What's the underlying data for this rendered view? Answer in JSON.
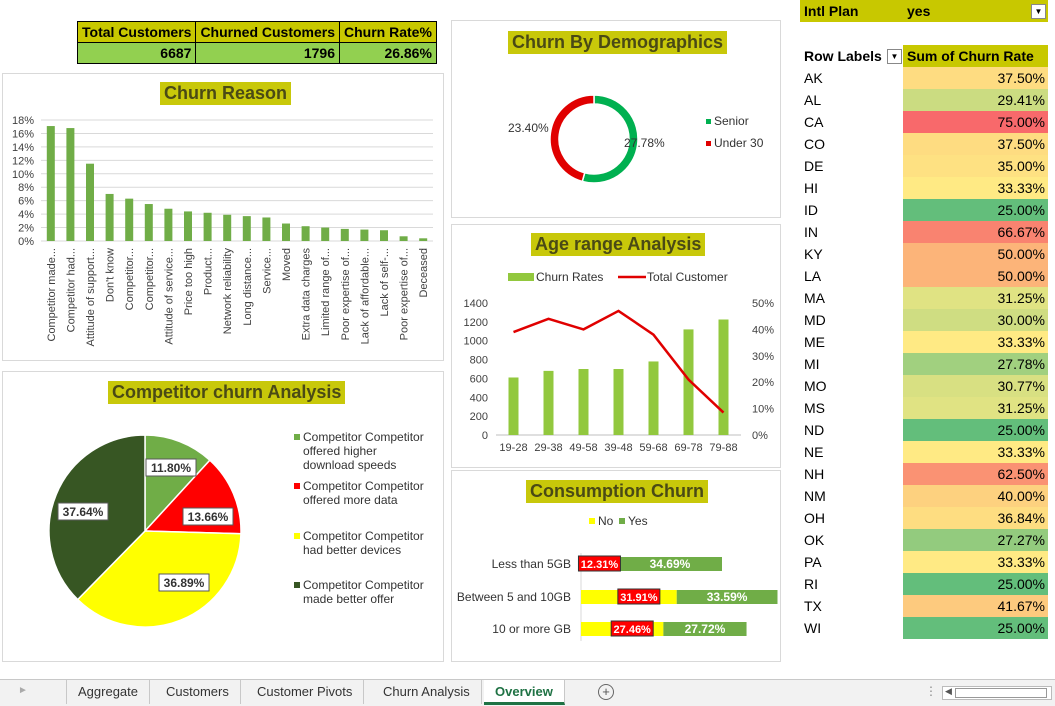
{
  "kpi": {
    "headers": [
      "Total Customers",
      "Churned Customers",
      "Churn Rate%"
    ],
    "values": [
      "6687",
      "1796",
      "26.86%"
    ]
  },
  "pivot": {
    "filter_label": "Intl Plan",
    "filter_value": "yes",
    "row_header": "Row Labels",
    "value_header": "Sum of Churn Rate",
    "rows": [
      {
        "state": "AK",
        "value": "37.50%",
        "color": "#fedc81"
      },
      {
        "state": "AL",
        "value": "29.41%",
        "color": "#cbdc81"
      },
      {
        "state": "CA",
        "value": "75.00%",
        "color": "#f8696b"
      },
      {
        "state": "CO",
        "value": "37.50%",
        "color": "#fedc81"
      },
      {
        "state": "DE",
        "value": "35.00%",
        "color": "#fee182"
      },
      {
        "state": "HI",
        "value": "33.33%",
        "color": "#ffea84"
      },
      {
        "state": "ID",
        "value": "25.00%",
        "color": "#63be7b"
      },
      {
        "state": "IN",
        "value": "66.67%",
        "color": "#f98370"
      },
      {
        "state": "KY",
        "value": "50.00%",
        "color": "#fcb479"
      },
      {
        "state": "LA",
        "value": "50.00%",
        "color": "#fcb479"
      },
      {
        "state": "MA",
        "value": "31.25%",
        "color": "#e0e383"
      },
      {
        "state": "MD",
        "value": "30.00%",
        "color": "#cfdd82"
      },
      {
        "state": "ME",
        "value": "33.33%",
        "color": "#ffea84"
      },
      {
        "state": "MI",
        "value": "27.78%",
        "color": "#a1d07f"
      },
      {
        "state": "MO",
        "value": "30.77%",
        "color": "#d8e082"
      },
      {
        "state": "MS",
        "value": "31.25%",
        "color": "#e0e383"
      },
      {
        "state": "ND",
        "value": "25.00%",
        "color": "#63be7b"
      },
      {
        "state": "NE",
        "value": "33.33%",
        "color": "#ffea84"
      },
      {
        "state": "NH",
        "value": "62.50%",
        "color": "#fa9273"
      },
      {
        "state": "NM",
        "value": "40.00%",
        "color": "#fdd17f"
      },
      {
        "state": "OH",
        "value": "36.84%",
        "color": "#fedd81"
      },
      {
        "state": "OK",
        "value": "27.27%",
        "color": "#93cb7e"
      },
      {
        "state": "PA",
        "value": "33.33%",
        "color": "#ffea84"
      },
      {
        "state": "RI",
        "value": "25.00%",
        "color": "#63be7b"
      },
      {
        "state": "TX",
        "value": "41.67%",
        "color": "#fdca7e"
      },
      {
        "state": "WI",
        "value": "25.00%",
        "color": "#63be7b"
      }
    ]
  },
  "chart_data": [
    {
      "type": "bar",
      "title": "Churn Reason",
      "color": "#70ad47",
      "ylim": [
        0,
        18
      ],
      "yticks": [
        "0%",
        "2%",
        "4%",
        "6%",
        "8%",
        "10%",
        "12%",
        "14%",
        "16%",
        "18%"
      ],
      "categories": [
        "Competitor made...",
        "Competitor had...",
        "Attitude of support...",
        "Don't know",
        "Competitor...",
        "Competitor...",
        "Attitude of service...",
        "Price too high",
        "Product...",
        "Network reliability",
        "Long distance...",
        "Service...",
        "Moved",
        "Extra data charges",
        "Limited range of...",
        "Poor expertise of...",
        "Lack of affordable...",
        "Lack of self-...",
        "Poor expertise of...",
        "Deceased"
      ],
      "values": [
        17.1,
        16.8,
        11.5,
        7.0,
        6.3,
        5.5,
        4.8,
        4.4,
        4.2,
        3.9,
        3.7,
        3.5,
        2.6,
        2.2,
        2.0,
        1.8,
        1.7,
        1.6,
        0.7,
        0.4
      ]
    },
    {
      "type": "pie",
      "title": "Churn By Demographics",
      "labels": [
        "Senior",
        "Under 30"
      ],
      "values": [
        27.78,
        23.4
      ],
      "value_labels": [
        "27.78%",
        "23.40%"
      ],
      "colors": [
        "#00b050",
        "#e00000"
      ]
    },
    {
      "type": "bar",
      "title": "Age range Analysis",
      "categories": [
        "19-28",
        "29-38",
        "49-58",
        "39-48",
        "59-68",
        "69-78",
        "79-88"
      ],
      "series": [
        {
          "name": "Churn Rates",
          "kind": "bar",
          "axis": "left",
          "color": "#92c83e",
          "values": [
            610,
            680,
            700,
            700,
            780,
            1120,
            1225
          ]
        },
        {
          "name": "Total Customer",
          "kind": "line",
          "axis": "right",
          "color": "#e00000",
          "values": [
            0.39,
            0.44,
            0.4,
            0.47,
            0.38,
            0.21,
            0.085
          ]
        }
      ],
      "left_axis": {
        "ylim": [
          0,
          1400
        ],
        "ticks": [
          "0",
          "200",
          "400",
          "600",
          "800",
          "1000",
          "1200",
          "1400"
        ]
      },
      "right_axis": {
        "ylim": [
          0,
          0.5
        ],
        "ticks": [
          "0%",
          "10%",
          "20%",
          "30%",
          "40%",
          "50%"
        ]
      }
    },
    {
      "type": "pie",
      "title": "Competitor churn Analysis",
      "labels": [
        "Competitor Competitor offered higher download speeds",
        "Competitor Competitor offered more data",
        "Competitor Competitor had better devices",
        "Competitor Competitor made better offer"
      ],
      "values": [
        11.8,
        13.66,
        36.89,
        37.64
      ],
      "value_labels": [
        "11.80%",
        "13.66%",
        "36.89%",
        "37.64%"
      ],
      "colors": [
        "#70ad47",
        "#ff0000",
        "#ffff00",
        "#375623"
      ]
    },
    {
      "type": "bar",
      "title": "Consumption Churn",
      "categories": [
        "Less than 5GB",
        "Between 5 and 10GB",
        "10 or more GB"
      ],
      "series": [
        {
          "name": "No",
          "color": "#ffff00",
          "values": [
            12.31,
            31.91,
            27.46
          ],
          "labels": [
            "12.31%",
            "31.91%",
            "27.46%"
          ]
        },
        {
          "name": "Yes",
          "color": "#70ad47",
          "values": [
            34.69,
            33.59,
            27.72
          ],
          "labels": [
            "34.69%",
            "33.59%",
            "27.72%"
          ]
        }
      ]
    }
  ],
  "tabs": [
    "Aggregate",
    "Customers",
    "Customer Pivots",
    "Churn Analysis",
    "Overview"
  ],
  "active_tab": "Overview",
  "add_sheet_icon": "plus-circle-icon"
}
